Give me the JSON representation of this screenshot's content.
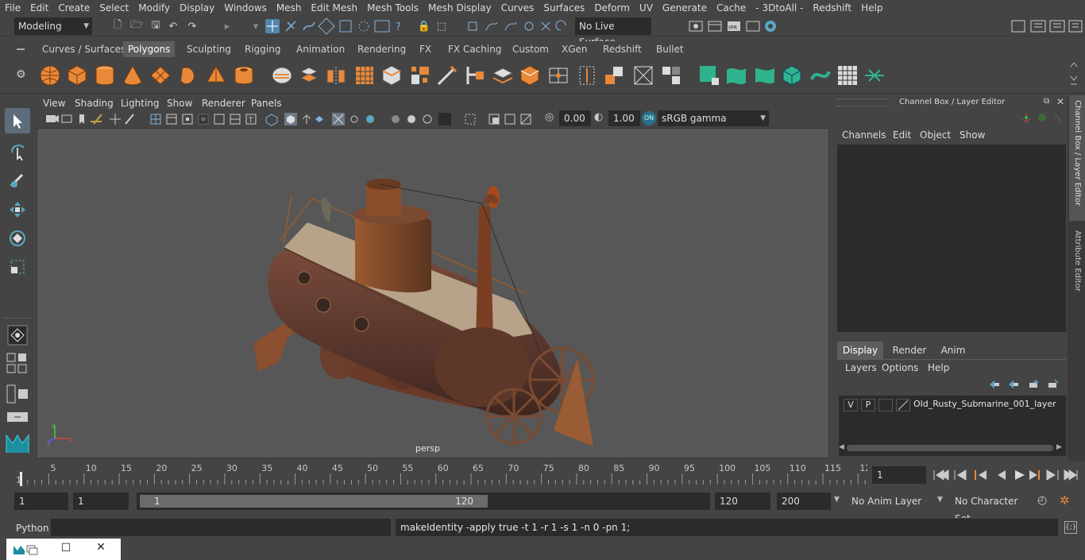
{
  "menubar": {
    "items": [
      "File",
      "Edit",
      "Create",
      "Select",
      "Modify",
      "Display",
      "Windows",
      "Mesh",
      "Edit Mesh",
      "Mesh Tools",
      "Mesh Display",
      "Curves",
      "Surfaces",
      "Deform",
      "UV",
      "Generate",
      "Cache",
      "- 3DtoAll -",
      "Redshift",
      "Help"
    ]
  },
  "statusline": {
    "mode": "Modeling",
    "live_surface": "No Live Surface"
  },
  "shelf_tabs": [
    "Curves / Surfaces",
    "Polygons",
    "Sculpting",
    "Rigging",
    "Animation",
    "Rendering",
    "FX",
    "FX Caching",
    "Custom",
    "XGen",
    "Redshift",
    "Bullet"
  ],
  "shelf_active_tab": "Polygons",
  "viewport": {
    "menu": [
      "View",
      "Shading",
      "Lighting",
      "Show",
      "Renderer",
      "Panels"
    ],
    "exposure": "0.00",
    "gamma": "1.00",
    "color_space": "sRGB gamma",
    "camera_label": "persp"
  },
  "channelbox": {
    "title": "Channel Box / Layer Editor",
    "menu": [
      "Channels",
      "Edit",
      "Object",
      "Show"
    ],
    "layer_tabs": [
      "Display",
      "Render",
      "Anim"
    ],
    "layer_active_tab": "Display",
    "layer_menu": [
      "Layers",
      "Options",
      "Help"
    ],
    "layer": {
      "visible": "V",
      "playback": "P",
      "name": "Old_Rusty_Submarine_001_layer"
    }
  },
  "side_tabs": [
    "Channel Box / Layer Editor",
    "Attribute Editor"
  ],
  "timeline": {
    "ticks": [
      "1",
      "5",
      "10",
      "15",
      "20",
      "25",
      "30",
      "35",
      "40",
      "45",
      "50",
      "55",
      "60",
      "65",
      "70",
      "75",
      "80",
      "85",
      "90",
      "95",
      "100",
      "105",
      "110",
      "115",
      "12"
    ],
    "current_frame": "1"
  },
  "range": {
    "start": "1",
    "playback_start": "1",
    "slider_start": "1",
    "slider_end": "120",
    "playback_end": "120",
    "end": "200",
    "anim_layer": "No Anim Layer",
    "character_set": "No Character Set"
  },
  "cmdline": {
    "language": "Python",
    "result": "makeIdentity -apply true -t 1 -r 1 -s 1 -n 0 -pn 1;"
  },
  "colors": {
    "accent": "#5285a6",
    "bg": "#444444",
    "viewport": "#575757",
    "shelf_orange": "#e8893a",
    "shelf_green": "#2fb38f"
  }
}
